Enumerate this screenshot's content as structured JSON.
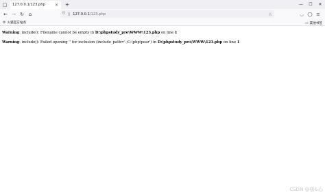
{
  "browser": {
    "tab": {
      "title": "127.0.0.1/123.php"
    },
    "url": {
      "host": "127.0.0.1",
      "path": "/123.php"
    },
    "bookmarks": {
      "left_label": "火狐官方站点",
      "right_label": "其他书签"
    }
  },
  "page": {
    "warnings": [
      {
        "label": "Warning",
        "text1": ": include(): Filename cannot be empty in ",
        "file": "D:\\phpstudy_pro\\WWW\\123.php",
        "text2": " on line ",
        "line": "1"
      },
      {
        "label": "Warning",
        "text1": ": include(): Failed opening '' for inclusion (include_path='.;C:\\php\\pear') in ",
        "file": "D:\\phpstudy_pro\\WWW\\123.php",
        "text2": " on line ",
        "line": "1"
      }
    ]
  },
  "watermark": "CSDN @极&心",
  "icons": {
    "tab_list": "tab-list-icon",
    "tab_close": "close-icon",
    "new_tab": "plus-icon",
    "back": "back-arrow-icon",
    "forward": "forward-arrow-icon",
    "reload": "reload-icon",
    "home": "home-icon",
    "shield": "shield-icon",
    "page": "page-icon",
    "bookmark_star": "star-icon",
    "pocket": "pocket-icon",
    "account": "account-icon",
    "menu": "hamburger-menu-icon"
  }
}
